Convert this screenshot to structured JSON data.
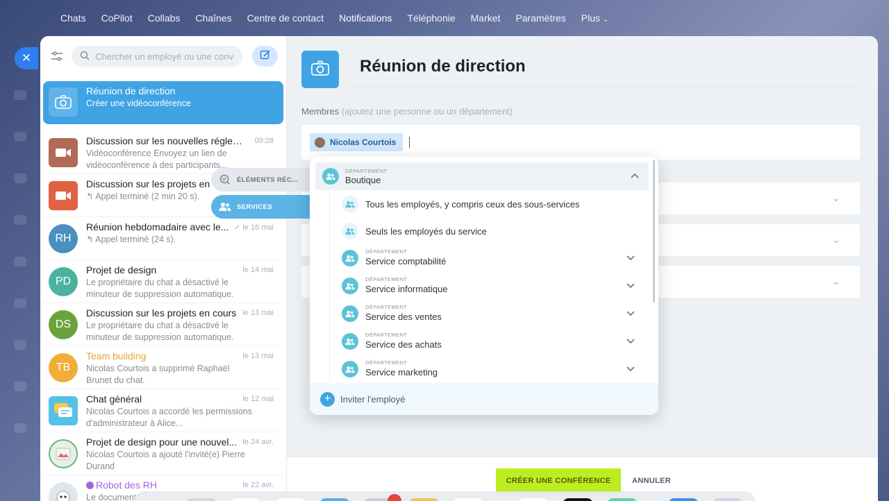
{
  "topnav": {
    "items": [
      "Chats",
      "CoPilot",
      "Collabs",
      "Chaînes",
      "Centre de contact",
      "Notifications",
      "Téléphonie",
      "Market",
      "Paramètres",
      "Plus"
    ]
  },
  "sidebar": {
    "search_placeholder": "Chercher un employé ou une conve",
    "chats": [
      {
        "title": "Réunion de direction",
        "subtitle": "Créer une vidéoconférence",
        "time": "",
        "avatar": "camera-icon"
      },
      {
        "title": "Discussion sur les nouvelles réglem...",
        "subtitle": "Vidéoconférence Envoyez un lien de vidéoconférence à des participants...",
        "time": "09:28",
        "avatar": "video-icon"
      },
      {
        "title": "Discussion sur les projets en cours",
        "subtitle": "↰ Appel terminé (2 min 20 s).",
        "time": "",
        "avatar": "video-icon"
      },
      {
        "title": "Réunion hebdomadaire avec le...",
        "subtitle": "↰ Appel terminé (24 s).",
        "time": "✓ le 16 mai",
        "avatar": "RH"
      },
      {
        "title": "Projet de design",
        "subtitle": "Le propriétaire du chat a désactivé le minuteur de suppression automatique.",
        "time": "le 14 mai",
        "avatar": "PD"
      },
      {
        "title": "Discussion sur les projets en cours",
        "subtitle": "Le propriétaire du chat a désactivé le minuteur de suppression automatique.",
        "time": "le 13 mai",
        "avatar": "DS"
      },
      {
        "title": "Team building",
        "subtitle": "Nicolas Courtois a supprimé Raphaël Brunet du chat.",
        "time": "le 13 mai",
        "avatar": "TB"
      },
      {
        "title": "Chat général",
        "subtitle": "Nicolas Courtois a accordé les permissions d'administrateur à Alice...",
        "time": "le 12 mai",
        "avatar": "chat-icon"
      },
      {
        "title": "Projet de design pour une nouvel...",
        "subtitle": "Nicolas Courtois a ajouté l'invité(e) Pierre Durand",
        "time": "le 24 avr.",
        "avatar": "image"
      },
      {
        "title": "Robot des RH",
        "subtitle": "Le document",
        "time": "le 22 avr.",
        "avatar": "robot"
      }
    ]
  },
  "main": {
    "title": "Réunion de direction",
    "members_label": "Membres",
    "members_hint": "(ajoutez une personne ou un département)",
    "member_chip": "Nicolas Courtois",
    "create_button": "CRÉER UNE CONFÉRENCE",
    "cancel_button": "ANNULER"
  },
  "popup": {
    "tabs": {
      "recent": "ÉLÉMENTS RÉC...",
      "services": "SERVICES"
    },
    "dept_caption": "DÉPARTEMENT",
    "head": {
      "name": "Boutique"
    },
    "options": [
      {
        "label": "Tous les employés, y compris ceux des sous-services"
      },
      {
        "label": "Seuls les employés du service"
      }
    ],
    "subdepts": [
      {
        "name": "Service comptabilité"
      },
      {
        "name": "Service informatique"
      },
      {
        "name": "Service des ventes"
      },
      {
        "name": "Service des achats"
      },
      {
        "name": "Service marketing"
      }
    ],
    "footer": "Inviter l'employé"
  },
  "colors": {
    "accent": "#3fa3e4",
    "create_button": "#bbed21",
    "dept_icon": "#5cc3d6"
  }
}
